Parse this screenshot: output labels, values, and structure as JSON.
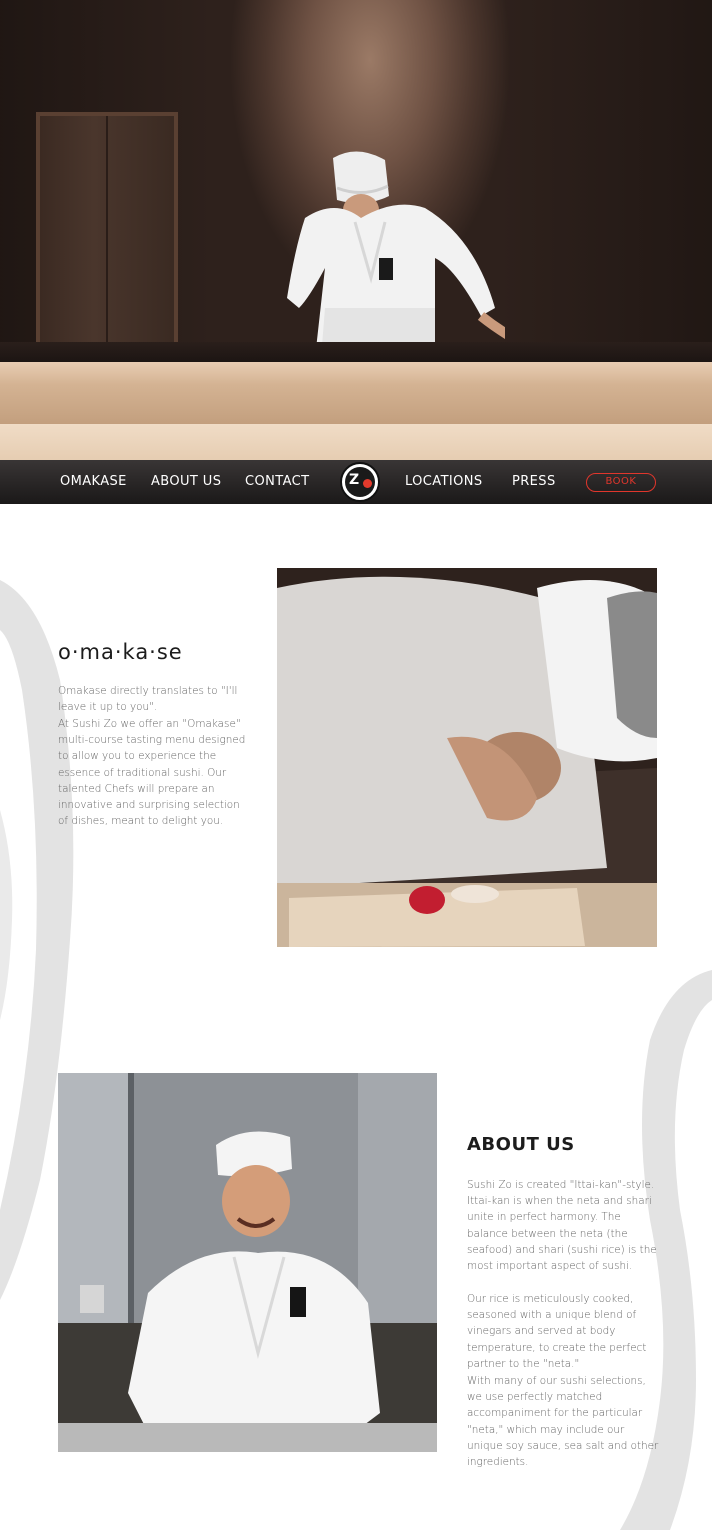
{
  "nav": {
    "items": [
      {
        "label": "OMAKASE"
      },
      {
        "label": "ABOUT US"
      },
      {
        "label": "CONTACT"
      },
      {
        "label": "LOCATIONS"
      },
      {
        "label": "PRESS"
      }
    ],
    "logo_text": "Z",
    "book_label": "BOOK"
  },
  "omakase": {
    "title": "o·ma·ka·se",
    "p1": "Omakase directly translates to \"I'll leave it up to you\".",
    "p2": "At Sushi Zo we offer an \"Omakase\" multi-course tasting menu designed to allow you to experience the essence of traditional sushi.  Our talented Chefs will prepare an innovative and surprising selection of dishes, meant to delight you."
  },
  "about": {
    "title": "ABOUT US",
    "p1": "Sushi Zo is created \"Ittai-kan\"-style. Ittai-kan is when the neta and shari unite in perfect harmony. The balance between the neta (the seafood) and shari (sushi rice) is the most important aspect of sushi.",
    "p2": "Our rice is meticulously cooked, seasoned with a unique blend of vinegars and served at body temperature, to create the perfect partner to the \"neta.\"",
    "p3": "With many of our sushi selections, we use perfectly matched accompaniment for the particular \"neta,\" which may include our unique soy sauce, sea salt and other ingredients."
  },
  "colors": {
    "accent": "#e0362c",
    "nav_bg": "#1c1a1a",
    "heading": "#1c1c1c",
    "body_text": "#666666"
  },
  "icons": [
    "sushi-zo-logo-icon"
  ]
}
